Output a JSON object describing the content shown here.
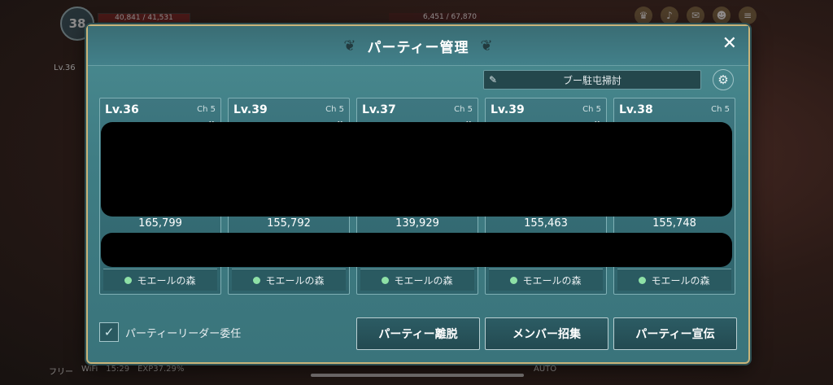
{
  "hud": {
    "player_level": "38",
    "hp_text": "40,841 / 41,531",
    "target_hp_text": "6,451 / 67,870",
    "party_member_level": "Lv.36",
    "free_label": "フリー",
    "wifi": "WiFi",
    "clock": "15:29",
    "exp": "EXP37.29%",
    "auto_label": "AUTO"
  },
  "dialog": {
    "title": "パーティー管理",
    "party_name": "ブー駐屯掃討",
    "members": [
      {
        "level": "Lv.36",
        "channel": "Ch 5",
        "power": "165,799",
        "location": "モエールの森"
      },
      {
        "level": "Lv.39",
        "channel": "Ch 5",
        "power": "155,792",
        "location": "モエールの森"
      },
      {
        "level": "Lv.37",
        "channel": "Ch 5",
        "power": "139,929",
        "location": "モエールの森"
      },
      {
        "level": "Lv.39",
        "channel": "Ch 5",
        "power": "155,463",
        "location": "モエールの森"
      },
      {
        "level": "Lv.38",
        "channel": "Ch 5",
        "power": "155,748",
        "location": "モエールの森"
      }
    ],
    "leader_delegate_label": "パーティーリーダー委任",
    "leave_button": "パーティー離脱",
    "recruit_button": "メンバー招集",
    "advertise_button": "パーティー宣伝"
  },
  "colors": {
    "accent": "#c9b47a",
    "panel": "#3f7d84",
    "location_dot": "#8ee0a6"
  },
  "icons": [
    "pencil-icon",
    "gear-icon",
    "close-icon",
    "chevron-down-icon",
    "checkmark-icon"
  ]
}
